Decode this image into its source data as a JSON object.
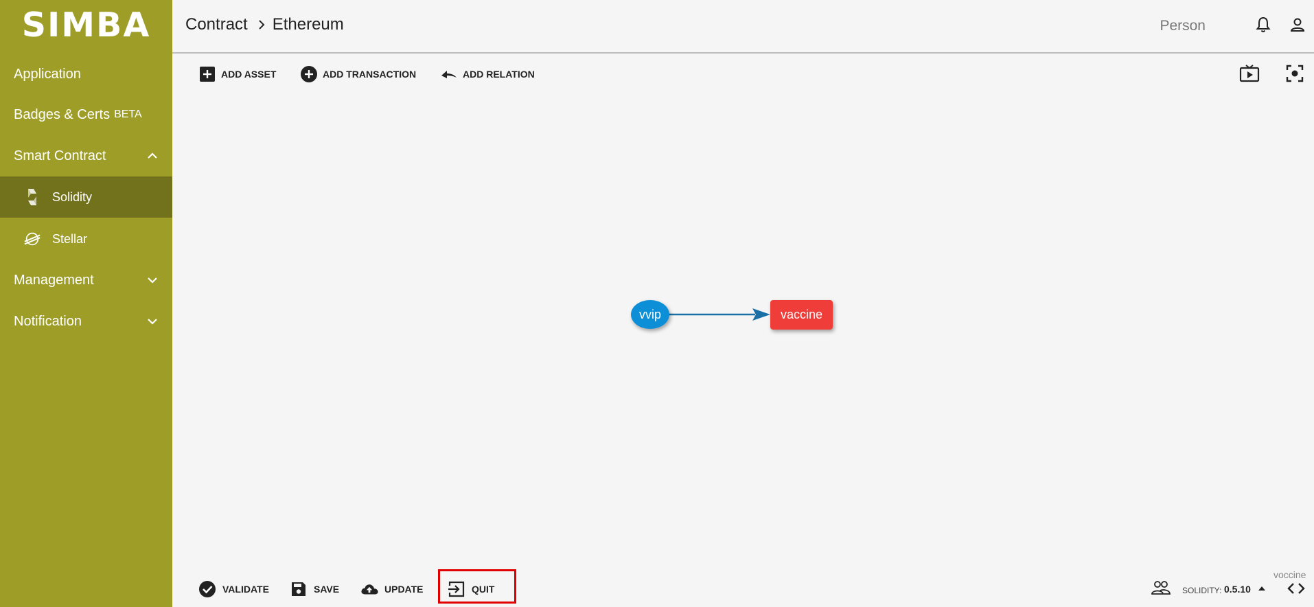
{
  "app": {
    "logo": "SIMBA"
  },
  "sidebar": {
    "items": [
      {
        "label": "Application"
      },
      {
        "label": "Badges & Certs",
        "badge": "BETA"
      },
      {
        "label": "Smart Contract",
        "expanded": true
      },
      {
        "label": "Solidity",
        "icon": "solidity-icon",
        "active": true
      },
      {
        "label": "Stellar",
        "icon": "stellar-icon"
      },
      {
        "label": "Management",
        "expanded": false
      },
      {
        "label": "Notification",
        "expanded": false
      }
    ]
  },
  "header": {
    "breadcrumb": [
      "Contract",
      "Ethereum"
    ],
    "user_label": "Person",
    "icons": [
      "bell-icon",
      "account-icon"
    ]
  },
  "toolbar": {
    "add_asset": "ADD ASSET",
    "add_transaction": "ADD TRANSACTION",
    "add_relation": "ADD RELATION",
    "right_icons": [
      "preview-tv-icon",
      "focus-center-icon"
    ]
  },
  "graph": {
    "nodes": [
      {
        "id": "vvip",
        "label": "vvip",
        "shape": "ellipse",
        "color": "#0d8fd8"
      },
      {
        "id": "vaccine",
        "label": "vaccine",
        "shape": "rectangle",
        "color": "#ef3d3a"
      }
    ],
    "edges": [
      {
        "from": "vvip",
        "to": "vaccine",
        "color": "#1a6fa6"
      }
    ]
  },
  "bottom": {
    "validate": "VALIDATE",
    "save": "SAVE",
    "update": "UPDATE",
    "quit": "QUIT",
    "solidity_label": "SOLIDITY:",
    "solidity_version": "0.5.10",
    "contract_name": "voccine"
  },
  "colors": {
    "sidebar": "#9d9d27",
    "sidebar_active": "#72721c",
    "highlight": "#e00000"
  }
}
